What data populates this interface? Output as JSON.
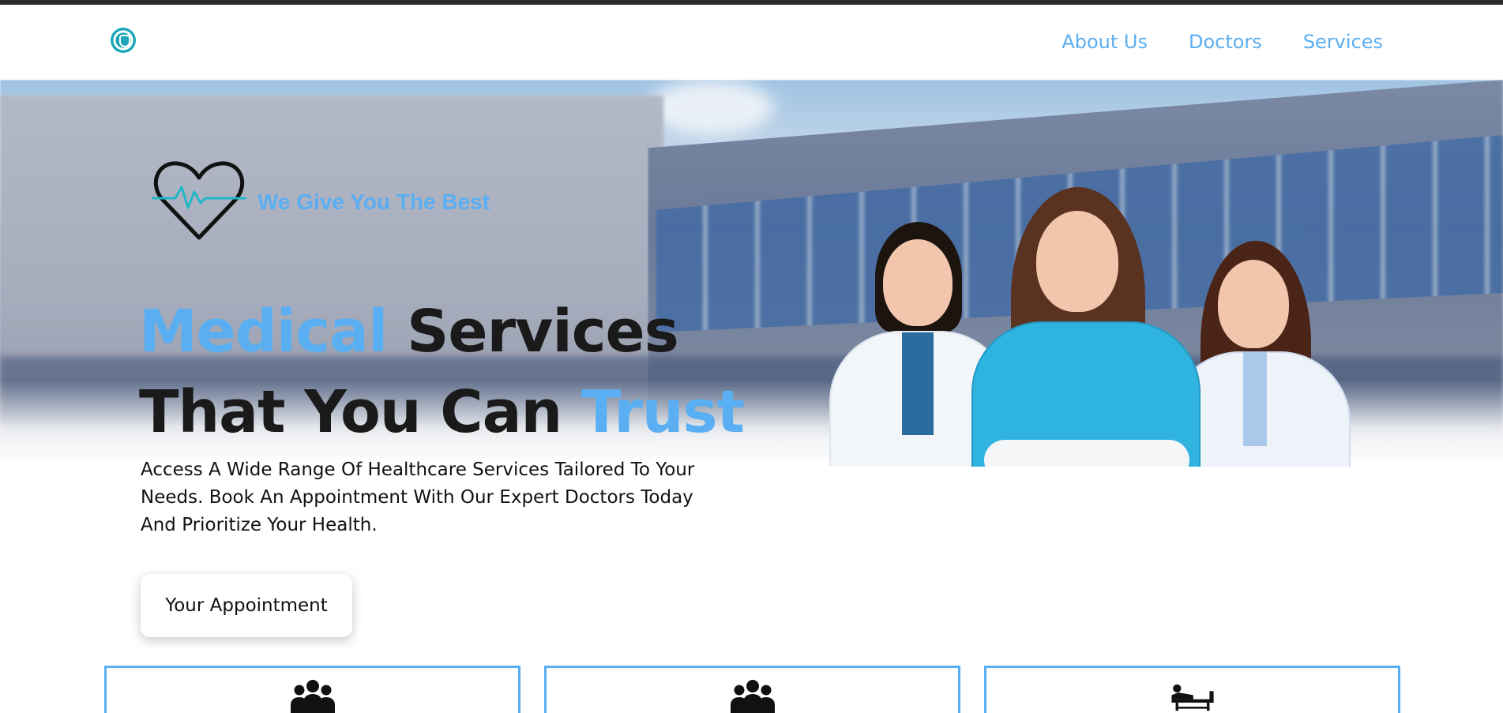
{
  "nav": {
    "logo_icon": "medical-logo-icon",
    "items": [
      {
        "label": "About Us"
      },
      {
        "label": "Doctors"
      },
      {
        "label": "Services"
      }
    ]
  },
  "hero": {
    "tagline_icon": "heartbeat-heart-icon",
    "tagline": "We Give You The Best",
    "title": {
      "line1_accent": "Medical",
      "line1_rest": " Services",
      "line2_rest": "That You Can ",
      "line2_accent": "Trust"
    },
    "description": "Access A Wide Range Of Healthcare Services Tailored To Your Needs. Book An Appointment With Our Expert Doctors Today And Prioritize Your Health.",
    "cta_label": "Your Appointment",
    "image_alt": "three-doctors-photo"
  },
  "cards": [
    {
      "icon": "people-group-icon"
    },
    {
      "icon": "people-group-icon"
    },
    {
      "icon": "hospital-bed-icon"
    }
  ],
  "colors": {
    "accent": "#5aaef2",
    "text": "#111111",
    "top_bar": "#2b2b2b"
  }
}
